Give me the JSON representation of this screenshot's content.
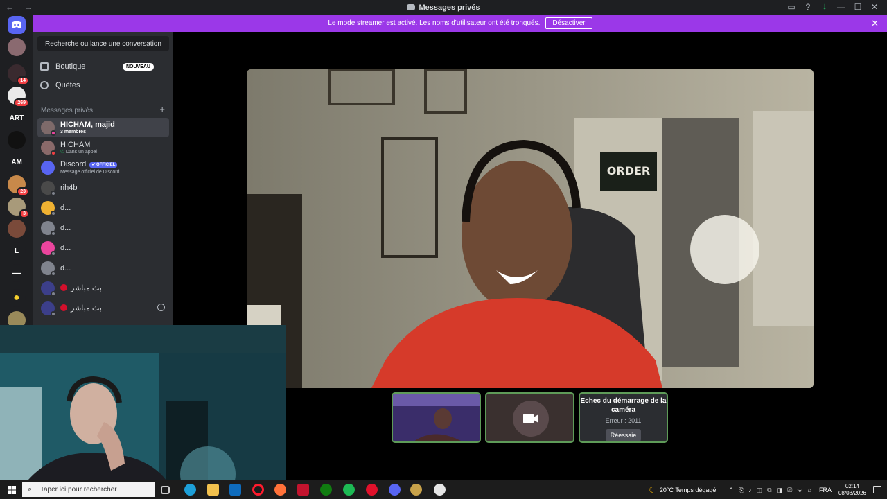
{
  "window": {
    "title": "Messages privés",
    "nav_arrows": "← →",
    "controls": [
      "▭",
      "?",
      "⤓",
      "—",
      "☐",
      "✕"
    ]
  },
  "banner": {
    "text": "Le mode streamer est activé. Les noms d'utilisateur ont été tronqués.",
    "button": "Désactiver",
    "close": "✕"
  },
  "guilds": [
    {
      "label": "",
      "badge": ""
    },
    {
      "label": "",
      "badge": "14"
    },
    {
      "label": "",
      "badge": "269"
    },
    {
      "label": "ART",
      "badge": ""
    },
    {
      "label": "",
      "badge": ""
    },
    {
      "label": "AM",
      "badge": ""
    },
    {
      "label": "",
      "badge": "23"
    },
    {
      "label": "",
      "badge": "3"
    },
    {
      "label": "",
      "badge": ""
    },
    {
      "label": "L",
      "badge": ""
    },
    {
      "label": "",
      "badge": ""
    },
    {
      "label": "",
      "badge": ""
    },
    {
      "label": "",
      "badge": ""
    }
  ],
  "sidebar": {
    "search_button": "Recherche ou lance une conversation",
    "boutique": "Boutique",
    "boutique_badge": "NOUVEAU",
    "quetes": "Quêtes",
    "dm_header": "Messages privés",
    "dm_plus": "+",
    "dms": [
      {
        "name": "HICHAM, majid",
        "sub": "3 membres"
      },
      {
        "name": "HICHAM",
        "sub": "Dans un appel"
      },
      {
        "name": "Discord",
        "sub": "Message officiel de Discord",
        "tag": "✔ OFFICIEL"
      },
      {
        "name": "rih4b",
        "sub": ""
      },
      {
        "name": "d...",
        "sub": ""
      },
      {
        "name": "d...",
        "sub": ""
      },
      {
        "name": "d...",
        "sub": ""
      },
      {
        "name": "d...",
        "sub": ""
      },
      {
        "name": "بث مباشر",
        "sub": ""
      },
      {
        "name": "بث مباشر",
        "sub": ""
      }
    ]
  },
  "call": {
    "camera_error_title": "Echec du démarrage de la caméra",
    "camera_error_code": "Erreur : 2011",
    "retry_button": "Réessaie"
  },
  "taskbar": {
    "search_placeholder": "Taper ici pour rechercher",
    "weather": "20°C  Temps dégagé",
    "lang": "FRA",
    "time": "02:14",
    "date": "08/08/2026"
  },
  "colors": {
    "accent": "#5865f2",
    "banner": "#9b38e8",
    "tile_border": "#5e9b58"
  }
}
